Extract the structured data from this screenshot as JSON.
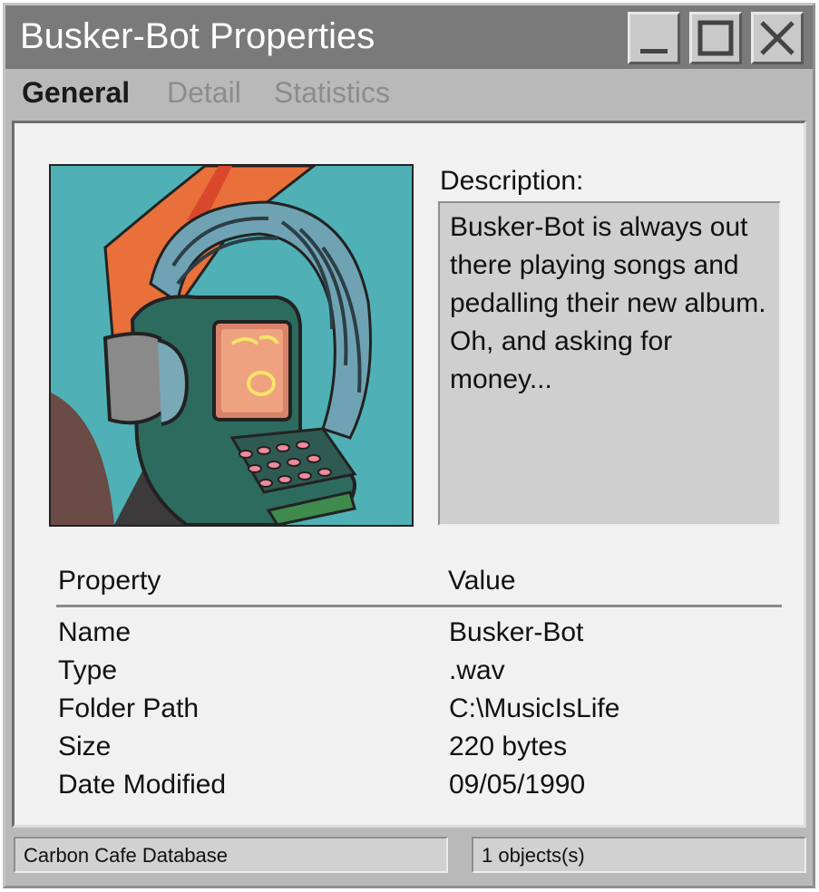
{
  "window": {
    "title": "Busker-Bot Properties",
    "buttons": {
      "minimize_icon": "minimize-icon",
      "maximize_icon": "maximize-icon",
      "close_icon": "close-icon"
    }
  },
  "tabs": [
    {
      "label": "General",
      "active": true
    },
    {
      "label": "Detail",
      "active": false
    },
    {
      "label": "Statistics",
      "active": false
    }
  ],
  "description": {
    "label": "Description:",
    "text": "Busker-Bot is always out there playing songs and pedalling their new album. Oh, and asking for money..."
  },
  "properties": {
    "header_property": "Property",
    "header_value": "Value",
    "rows": [
      {
        "key": "Name",
        "value": "Busker-Bot"
      },
      {
        "key": "Type",
        "value": ".wav"
      },
      {
        "key": "Folder Path",
        "value": "C:\\MusicIsLife"
      },
      {
        "key": "Size",
        "value": "220 bytes"
      },
      {
        "key": "Date Modified",
        "value": "09/05/1990"
      }
    ]
  },
  "statusbar": {
    "left": "Carbon Cafe Database",
    "right": "1 objects(s)"
  },
  "colors": {
    "titlebar": "#7a7a7a",
    "panel": "#f1f1f1",
    "portrait_bg": "#4fb1b5"
  }
}
